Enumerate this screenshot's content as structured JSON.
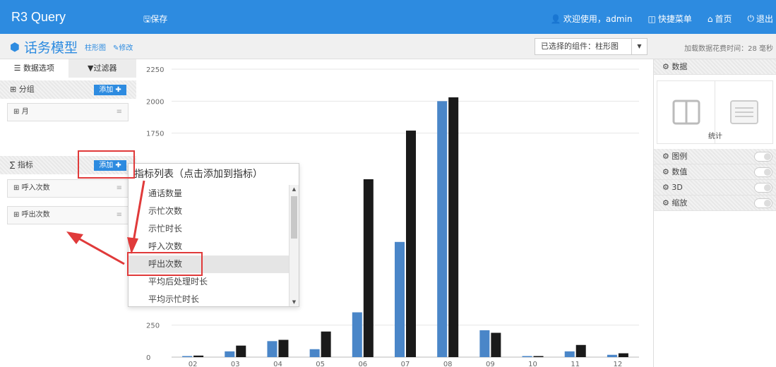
{
  "topbar": {
    "brand": "R3 Query",
    "save": "保存",
    "welcome": "欢迎使用，admin",
    "quick_menu": "快捷菜单",
    "home": "首页",
    "logout": "退出"
  },
  "subbar": {
    "title": "话务模型",
    "chart_type": "柱形图",
    "edit": "修改",
    "selected_component": "已选择的组件：柱形图",
    "load_time": "加载数据花费时间：28 毫秒"
  },
  "left": {
    "tab_data": "数据选项",
    "tab_filter": "过滤器",
    "group_label": "分组",
    "add_label": "添加",
    "group_fields": [
      "月"
    ],
    "metric_label": "指标",
    "metric_fields": [
      "呼入次数",
      "呼出次数"
    ]
  },
  "popup": {
    "title": "指标列表（点击添加到指标）",
    "items": [
      "通话数量",
      "示忙次数",
      "示忙时长",
      "呼入次数",
      "呼出次数",
      "平均后处理时长",
      "平均示忙时长"
    ],
    "selected": "呼出次数"
  },
  "right": {
    "data": "数据",
    "stat": "统计",
    "legend": "图例",
    "values": "数值",
    "three_d": "3D",
    "zoom": "缩放"
  },
  "chart_data": {
    "type": "bar",
    "categories": [
      "02",
      "03",
      "04",
      "05",
      "06",
      "07",
      "08",
      "09",
      "10",
      "11",
      "12"
    ],
    "series": [
      {
        "values": [
          8,
          45,
          125,
          62,
          350,
          900,
          2000,
          210,
          0,
          45,
          18
        ]
      },
      {
        "values": [
          12,
          90,
          135,
          200,
          1390,
          1770,
          2030,
          190,
          0,
          95,
          30
        ]
      }
    ],
    "y_ticks": [
      0,
      250,
      1750,
      2000,
      2250
    ],
    "ylim": [
      0,
      2250
    ],
    "colors": [
      "#4a86c8",
      "#1a1a1a"
    ]
  }
}
